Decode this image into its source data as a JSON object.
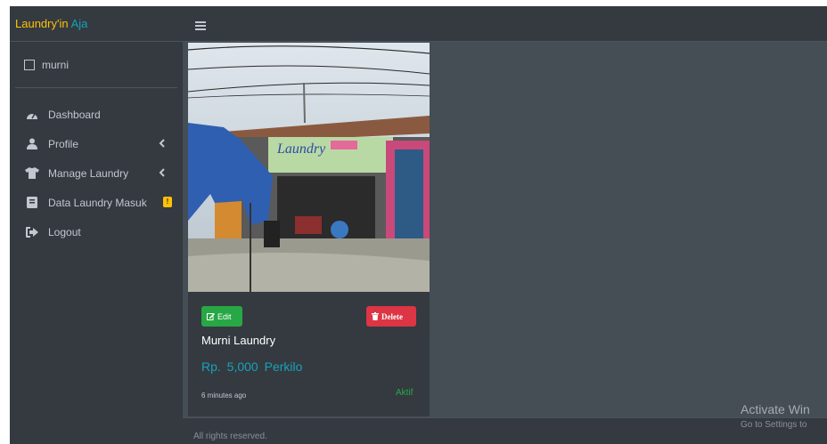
{
  "brand": {
    "part1": "Laundry'in",
    "part2": "Aja"
  },
  "user": {
    "name": "murni"
  },
  "sidebar": {
    "items": [
      {
        "label": "Dashboard",
        "icon": "tachometer-icon"
      },
      {
        "label": "Profile",
        "icon": "user-icon",
        "chevron": true
      },
      {
        "label": "Manage Laundry",
        "icon": "tshirt-icon",
        "chevron": true
      },
      {
        "label": "Data Laundry Masuk",
        "icon": "book-icon",
        "badge": "!"
      },
      {
        "label": "Logout",
        "icon": "sign-out-icon"
      }
    ]
  },
  "card": {
    "edit_label": "Edit",
    "delete_label": "Delete",
    "title": "Murni Laundry",
    "price": "Rp. 5,000",
    "unit": "Perkilo",
    "time": "6 minutes ago",
    "status": "Aktif"
  },
  "footer": {
    "text": "All rights reserved."
  },
  "watermark": {
    "line1": "Activate Win",
    "line2": "Go to Settings to"
  },
  "colors": {
    "sidebar": "#343a40",
    "content": "#454d55",
    "brand": "#ffc107",
    "accent": "#17a2b8",
    "success": "#28a745",
    "danger": "#dc3545"
  }
}
